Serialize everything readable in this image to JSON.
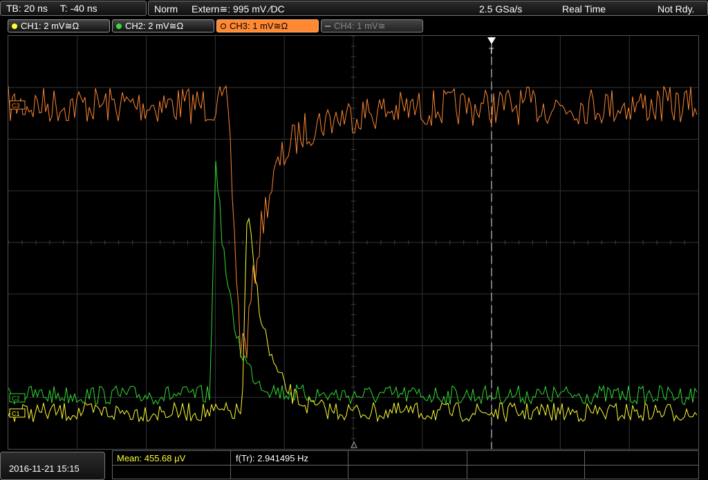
{
  "timebase": {
    "tb": "TB: 20 ns",
    "trigger_offset": "T: -40 ns"
  },
  "acquisition": {
    "mode": "Norm",
    "trigger": "Extern≅: 995 mV ⁄DC",
    "sample_rate": "2.5 GSa/s",
    "realtime": "Real Time",
    "status": "Not Rdy."
  },
  "channels": [
    {
      "label": "CH1: 2 mV≅Ω",
      "color": "#ffff33",
      "active": true
    },
    {
      "label": "CH2: 2 mV≅Ω",
      "color": "#33dd33",
      "active": true
    },
    {
      "label": "CH3: 1 mV≅Ω",
      "color": "#ff8833",
      "active": true,
      "selected": true
    },
    {
      "label": "CH4: 1 mV≅",
      "color": "#777777",
      "active": false
    }
  ],
  "markers": {
    "ch3": "C3",
    "ch2": "C2",
    "ch1": "C1",
    "trigger": "T"
  },
  "measurements": {
    "mean": "Mean: 455.68 µV",
    "freq": "f(Tr): 2.941495 Hz"
  },
  "datetime": "2016-11-21 15:15"
}
